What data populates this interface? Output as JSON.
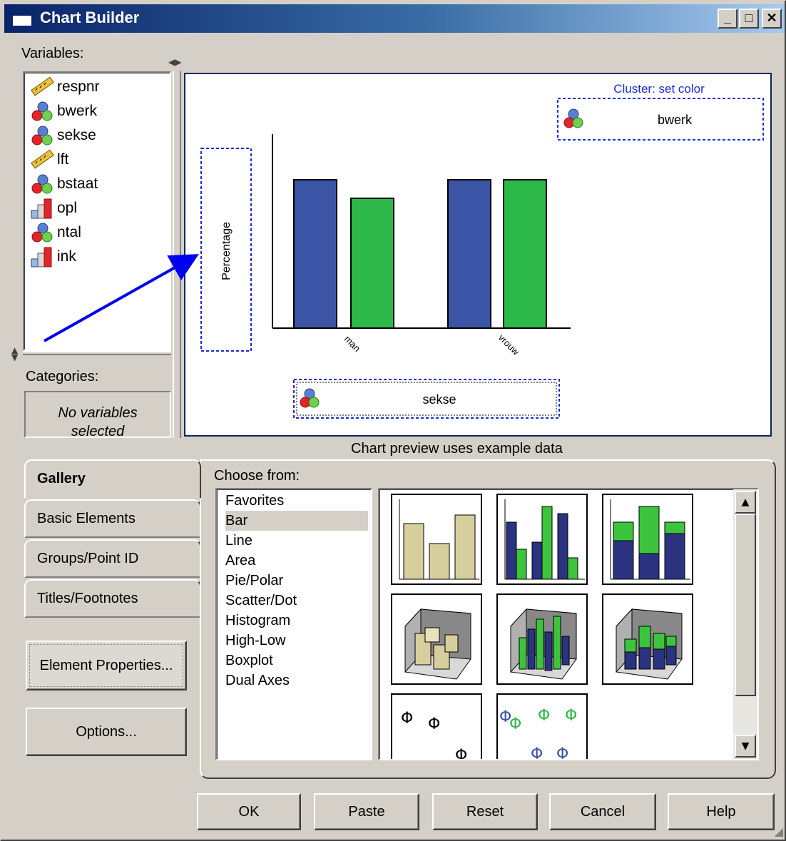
{
  "window": {
    "title": "Chart Builder",
    "minimize": "_",
    "maximize": "□",
    "close": "✕"
  },
  "variables": {
    "label": "Variables:",
    "items": [
      {
        "name": "respnr",
        "icon": "scale-ruler-icon"
      },
      {
        "name": "bwerk",
        "icon": "nominal-balls-icon"
      },
      {
        "name": "sekse",
        "icon": "nominal-balls-icon"
      },
      {
        "name": "lft",
        "icon": "scale-ruler-icon"
      },
      {
        "name": "bstaat",
        "icon": "nominal-balls-icon"
      },
      {
        "name": "opl",
        "icon": "ordinal-bars-icon"
      },
      {
        "name": "ntal",
        "icon": "nominal-balls-icon"
      },
      {
        "name": "ink",
        "icon": "ordinal-bars-icon"
      }
    ]
  },
  "categories": {
    "label": "Categories:",
    "empty": "No variables selected"
  },
  "canvas": {
    "cluster_label": "Cluster: set color",
    "cluster_var": "bwerk",
    "y_drop": "Percentage",
    "x_drop": "sekse",
    "x_ticks": [
      "man",
      "vrouw"
    ],
    "bar_colors": [
      "#3b54a5",
      "#2db84a"
    ],
    "note": "Chart preview uses example data"
  },
  "tabs": [
    {
      "label": "Gallery",
      "active": true
    },
    {
      "label": "Basic Elements"
    },
    {
      "label": "Groups/Point ID"
    },
    {
      "label": "Titles/Footnotes"
    }
  ],
  "buttons": {
    "element_properties": "Element Properties...",
    "options": "Options...",
    "ok": "OK",
    "paste": "Paste",
    "reset": "Reset",
    "cancel": "Cancel",
    "help": "Help"
  },
  "gallery": {
    "choose_label": "Choose from:",
    "items": [
      "Favorites",
      "Bar",
      "Line",
      "Area",
      "Pie/Polar",
      "Scatter/Dot",
      "Histogram",
      "High-Low",
      "Boxplot",
      "Dual Axes"
    ],
    "selected": "Bar"
  }
}
